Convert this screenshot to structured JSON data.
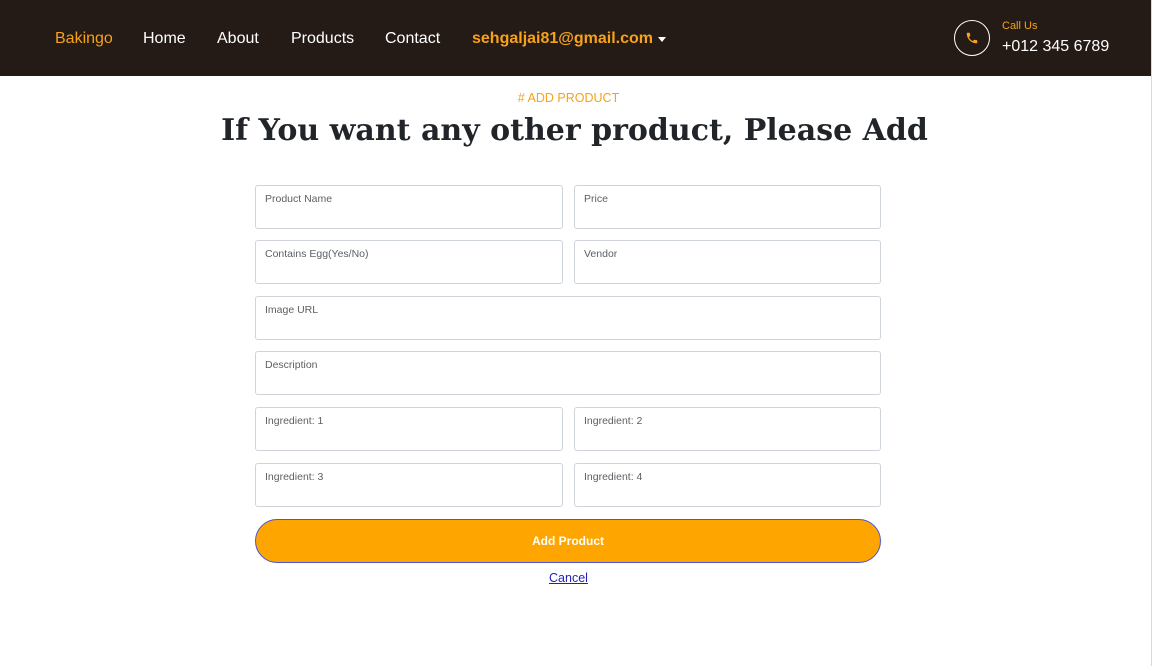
{
  "navbar": {
    "brand": "Bakingo",
    "links": {
      "home": "Home",
      "about": "About",
      "products": "Products",
      "contact": "Contact"
    },
    "account_email": "sehgaljai81@gmail.com",
    "call_label": "Call Us",
    "call_number": "+012 345 6789",
    "phone_icon": "phone-icon"
  },
  "section": {
    "tag": "# ADD PRODUCT",
    "title": "If You want any other product, Please Add"
  },
  "form": {
    "product_name_label": "Product Name",
    "price_label": "Price",
    "contains_egg_label": "Contains Egg(Yes/No)",
    "vendor_label": "Vendor",
    "image_url_label": "Image URL",
    "description_label": "Description",
    "ingredient_1_label": "Ingredient: 1",
    "ingredient_2_label": "Ingredient: 2",
    "ingredient_3_label": "Ingredient: 3",
    "ingredient_4_label": "Ingredient: 4",
    "submit_label": "Add Product",
    "cancel_label": "Cancel"
  },
  "colors": {
    "navbar_bg": "#241a16",
    "accent": "#f6a21a",
    "button_bg": "#ffa500",
    "link": "#1f1fbf"
  }
}
